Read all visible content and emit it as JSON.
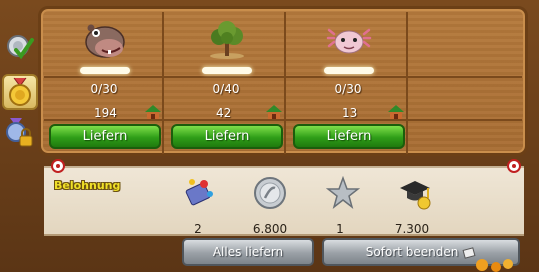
{
  "columns": [
    {
      "icon": "hippo-icon",
      "progress": "0/30",
      "progress_fraction": 0.0,
      "stock": "194",
      "button": "Liefern"
    },
    {
      "icon": "tree-icon",
      "progress": "0/40",
      "progress_fraction": 0.0,
      "stock": "42",
      "button": "Liefern"
    },
    {
      "icon": "axolotl-icon",
      "progress": "0/30",
      "progress_fraction": 0.0,
      "stock": "13",
      "button": "Liefern"
    }
  ],
  "reward": {
    "title": "Belohnung",
    "items": [
      {
        "icon": "fireworks-icon",
        "value": "2"
      },
      {
        "icon": "silver-coin-icon",
        "value": "6.800"
      },
      {
        "icon": "star-icon",
        "value": "1"
      },
      {
        "icon": "graduation-cap-icon",
        "value": "7.300"
      }
    ]
  },
  "buttons": {
    "deliver_all": "Alles liefern",
    "finish_now": "Sofort beenden"
  },
  "side_tabs": [
    {
      "icon": "medal-check-icon"
    },
    {
      "icon": "gold-medal-icon",
      "active": true
    },
    {
      "icon": "medal-locked-icon"
    }
  ]
}
